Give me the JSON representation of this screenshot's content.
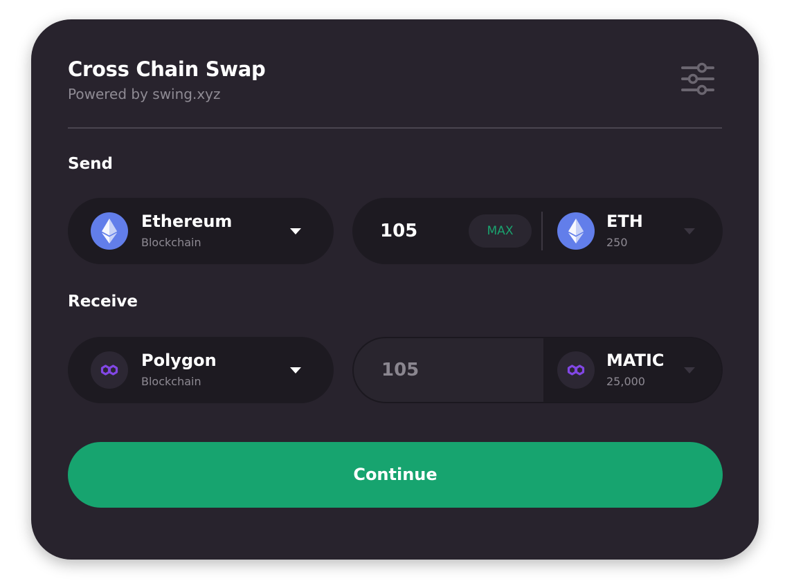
{
  "header": {
    "title": "Cross Chain Swap",
    "subtitle": "Powered by swing.xyz",
    "settings_icon": "sliders-icon"
  },
  "send": {
    "label": "Send",
    "chain": {
      "name": "Ethereum",
      "type": "Blockchain",
      "icon": "ethereum-icon"
    },
    "amount": "105",
    "max_label": "MAX",
    "token": {
      "symbol": "ETH",
      "balance": "250",
      "icon": "ethereum-icon"
    }
  },
  "receive": {
    "label": "Receive",
    "chain": {
      "name": "Polygon",
      "type": "Blockchain",
      "icon": "polygon-icon"
    },
    "amount": "105",
    "token": {
      "symbol": "MATIC",
      "balance": "25,000",
      "icon": "polygon-icon"
    }
  },
  "continue_label": "Continue",
  "colors": {
    "card_background": "#28232d",
    "pill_background": "#1d1a21",
    "accent_green": "#17a46f",
    "ethereum_blue": "#627eea",
    "polygon_purple": "#8247e5"
  }
}
